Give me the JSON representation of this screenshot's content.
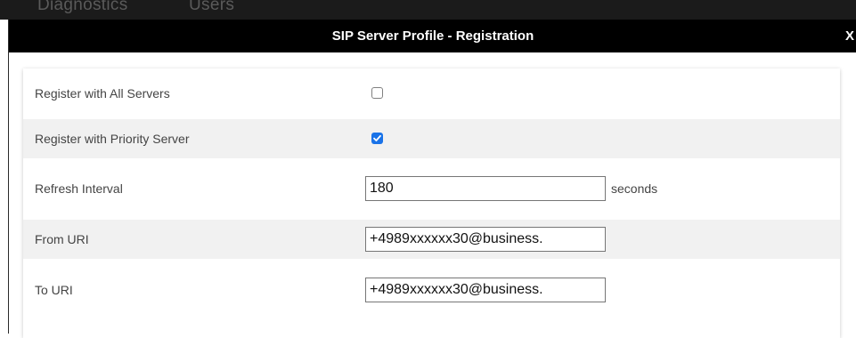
{
  "background_nav": {
    "items": [
      "Diagnostics",
      "Users"
    ]
  },
  "dialog": {
    "title": "SIP Server Profile - Registration",
    "close_label": "X"
  },
  "form": {
    "register_all_servers": {
      "label": "Register with All Servers",
      "checked": false
    },
    "register_priority_server": {
      "label": "Register with Priority Server",
      "checked": true
    },
    "refresh_interval": {
      "label": "Refresh Interval",
      "value": "180",
      "unit": "seconds"
    },
    "from_uri": {
      "label": "From URI",
      "value": "+4989xxxxxx30@business."
    },
    "to_uri": {
      "label": "To URI",
      "value": "+4989xxxxxx30@business."
    }
  },
  "colors": {
    "titlebar": "#000000",
    "checkbox_accent": "#1a73e8",
    "alt_row": "#f1f1f1"
  }
}
